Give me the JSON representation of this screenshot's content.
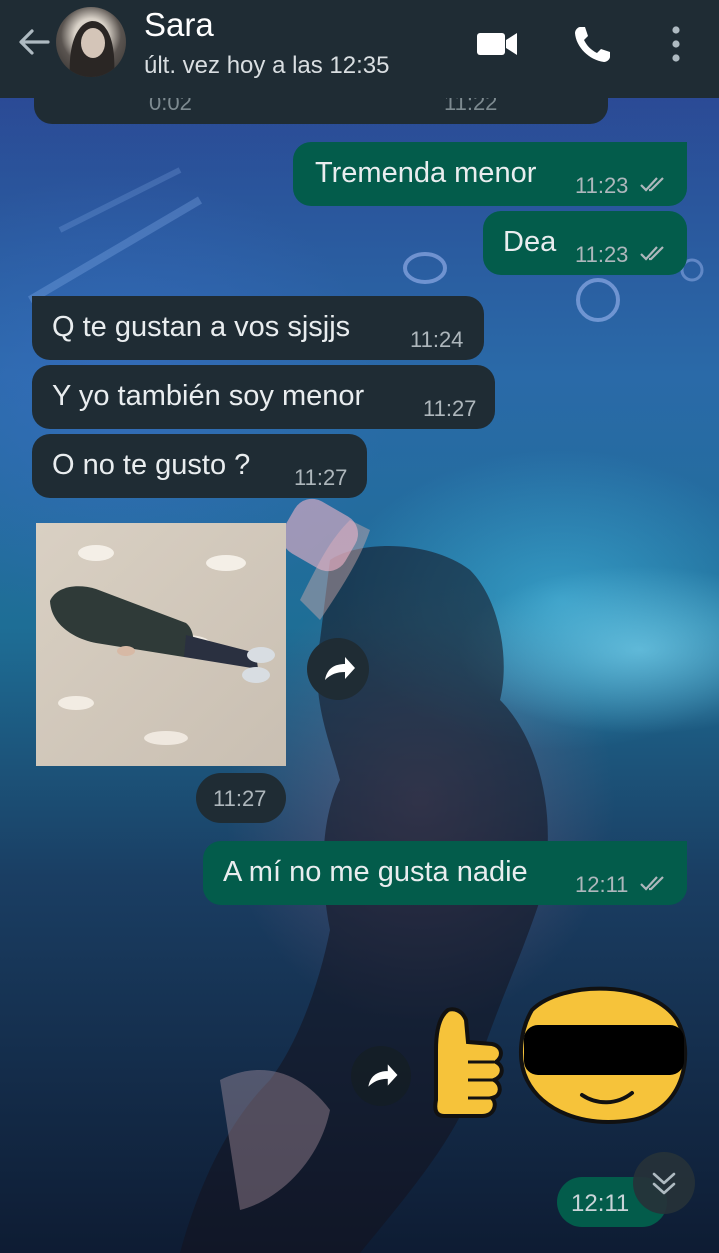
{
  "header": {
    "contact_name": "Sara",
    "last_seen": "últ. vez hoy a las 12:35",
    "icons": [
      "back-arrow-icon",
      "video-call-icon",
      "voice-call-icon",
      "more-options-icon"
    ]
  },
  "cut_message": {
    "duration": "0:02",
    "time": "11:22"
  },
  "messages": [
    {
      "direction": "out",
      "text": "Tremenda menor",
      "time": "11:23"
    },
    {
      "direction": "out",
      "text": "Dea",
      "time": "11:23"
    },
    {
      "direction": "in",
      "text": "Q te gustan a vos sjsjjs",
      "time": "11:24"
    },
    {
      "direction": "in",
      "text": "Y yo también soy menor",
      "time": "11:27"
    },
    {
      "direction": "in",
      "text": "O no te gusto ?",
      "time": "11:27"
    },
    {
      "direction": "in",
      "type": "image",
      "time": "11:27"
    },
    {
      "direction": "out",
      "text": "A mí no me gusta nadie",
      "time": "12:11"
    },
    {
      "direction": "out",
      "type": "sticker",
      "time": "12:11"
    }
  ],
  "colors": {
    "header_bg": "#1f2c34",
    "outgoing_bubble": "#035c4b",
    "incoming_bubble": "#1f2c34",
    "read_ticks": "#aeb7bc"
  }
}
